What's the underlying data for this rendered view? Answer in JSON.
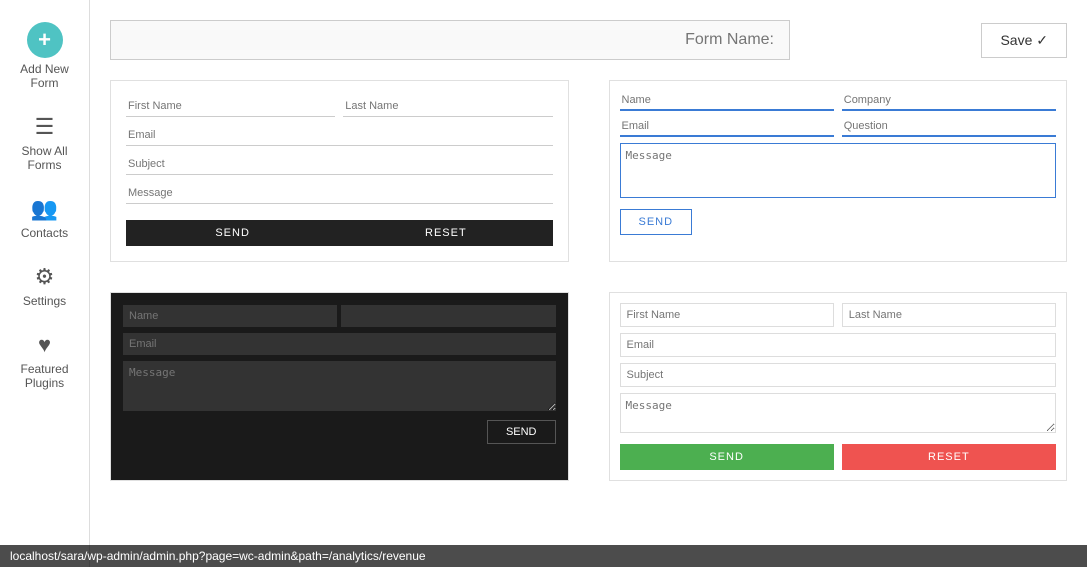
{
  "sidebar": {
    "add_new_label": "Add New Form",
    "show_forms_label": "Show All Forms",
    "contacts_label": "Contacts",
    "settings_label": "Settings",
    "featured_plugins_label": "Featured Plugins"
  },
  "header": {
    "form_name_placeholder": ":Form Name",
    "save_label": "Save ✓"
  },
  "forms": [
    {
      "id": "form1",
      "style": "white",
      "fields": [
        "First Name",
        "Last Name",
        "Email",
        "Subject",
        "Message"
      ],
      "buttons": [
        "SEND",
        "RESET"
      ]
    },
    {
      "id": "form2",
      "style": "blue-outline",
      "fields": [
        "Name",
        "Company",
        "Email",
        "Question",
        "Message"
      ],
      "buttons": [
        "SEND"
      ]
    },
    {
      "id": "form3",
      "style": "dark",
      "fields": [
        "Name",
        "Email",
        "Message"
      ],
      "buttons": [
        "SEND"
      ]
    },
    {
      "id": "form4",
      "style": "light-colored-buttons",
      "fields": [
        "First Name",
        "Last Name",
        "Email",
        "Subject",
        "Message"
      ],
      "buttons": [
        "SEND",
        "RESET"
      ]
    }
  ],
  "bottom_bar": {
    "url": "localhost/sara/wp-admin/admin.php?page=wc-admin&path=/analytics/revenue"
  }
}
